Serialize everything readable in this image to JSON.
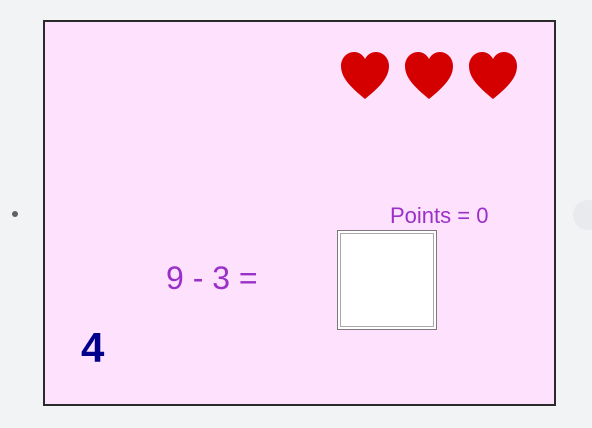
{
  "game": {
    "lives": 3,
    "points_text": "Points = 0",
    "equation": "9 - 3 =",
    "answer_value": "",
    "level_number": "4"
  },
  "colors": {
    "board_background": "#fde1fd",
    "heart": "#d40000",
    "text_purple": "#9b30c8",
    "level_blue": "#00008b"
  },
  "icons": {
    "heart": "heart-icon"
  }
}
